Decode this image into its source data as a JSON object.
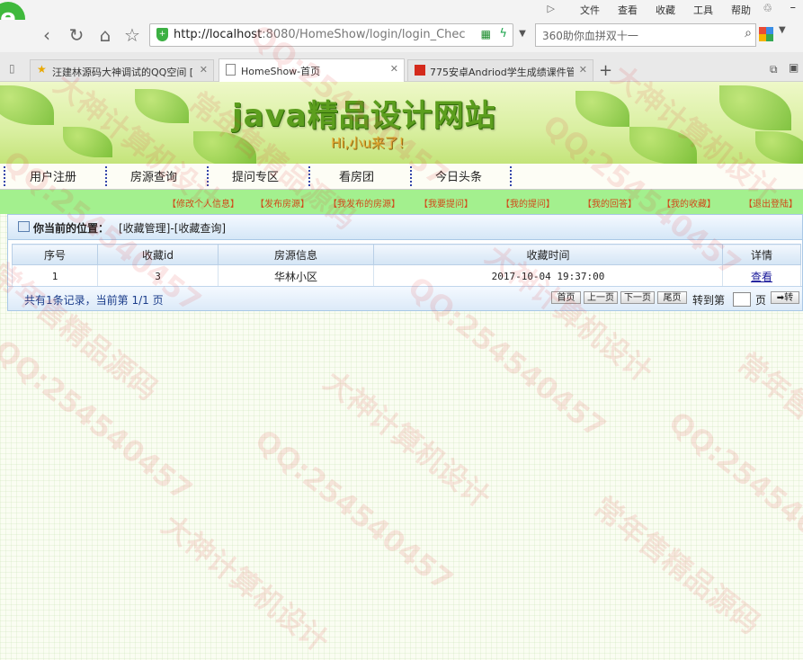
{
  "browser": {
    "menu": {
      "sidebar_icon": "▷",
      "file": "文件",
      "view": "查看",
      "favorites": "收藏",
      "tools": "工具",
      "help": "帮助"
    },
    "logo": "e",
    "url": {
      "host": "http://localhost",
      "rest": ":8080/HomeShow/login/login_Chec"
    },
    "search_placeholder": "360助你血拼双十一",
    "tabs": [
      {
        "title": "汪建林源码大神调试的QQ空间 ["
      },
      {
        "title": "HomeShow-首页"
      },
      {
        "title": "775安卓Andriod学生成绩课件管"
      }
    ],
    "new_tab": "+",
    "icons": {
      "back": "back-arrow-icon",
      "reload": "reload-icon",
      "home": "home-icon",
      "favorite": "star-icon",
      "security": "shield-icon",
      "search": "search-icon",
      "apps": "apps-icon",
      "close_tab": "close-icon"
    }
  },
  "site": {
    "title": "java精品设计网站",
    "subtitle": "Hi,小u来了！"
  },
  "nav": [
    "用户注册",
    "房源查询",
    "提问专区",
    "看房团",
    "今日头条"
  ],
  "user_links": [
    "【修改个人信息】",
    "【发布房源】",
    "【我发布的房源】",
    "【我要提问】",
    "【我的提问】",
    "【我的回答】",
    "【我的收藏】",
    "【退出登陆】"
  ],
  "panel": {
    "location_label": "你当前的位置：",
    "location_path": "[收藏管理]-[收藏查询]",
    "columns": [
      "序号",
      "收藏id",
      "房源信息",
      "收藏时间",
      "详情"
    ],
    "rows": [
      {
        "no": "1",
        "fav_id": "3",
        "house": "华林小区",
        "time": "2017-10-04 19:37:00",
        "detail": "查看"
      }
    ],
    "footer": {
      "summary": "共有1条记录，当前第 1/1 页",
      "first": "首页",
      "prev": "上一页",
      "next": "下一页",
      "last": "尾页",
      "goto_label": "转到第",
      "page_unit": "页",
      "go": "➡转"
    }
  },
  "watermark": [
    "QQ:254540457",
    "大神计算机设计",
    "常年售精品源码"
  ],
  "colors": {
    "banner_green": "#c4e47a",
    "userbar": "#a3f08e",
    "panel_border": "#a9c8e6",
    "link_red": "#d04a1a"
  }
}
